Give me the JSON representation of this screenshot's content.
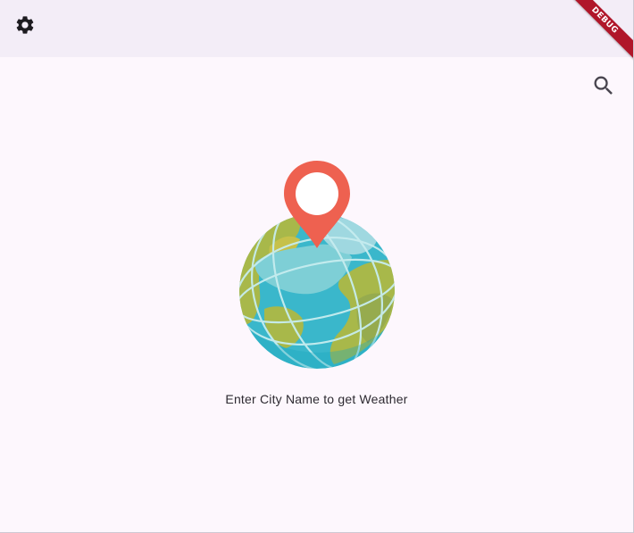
{
  "app_bar": {
    "settings_icon": "gear-icon"
  },
  "toolbar": {
    "search_icon": "search-icon"
  },
  "illustration": {
    "icon": "globe-location-pin-illustration"
  },
  "main": {
    "prompt": "Enter City Name to get Weather"
  },
  "debug_banner": {
    "label": "DEBUG"
  },
  "colors": {
    "app_bar_bg": "#f3edf7",
    "page_bg": "#fdf7fd",
    "pin": "#ee6150",
    "ocean": "#3ab7cb",
    "land": "#a8b84a",
    "debug_ribbon": "#b0162a"
  }
}
